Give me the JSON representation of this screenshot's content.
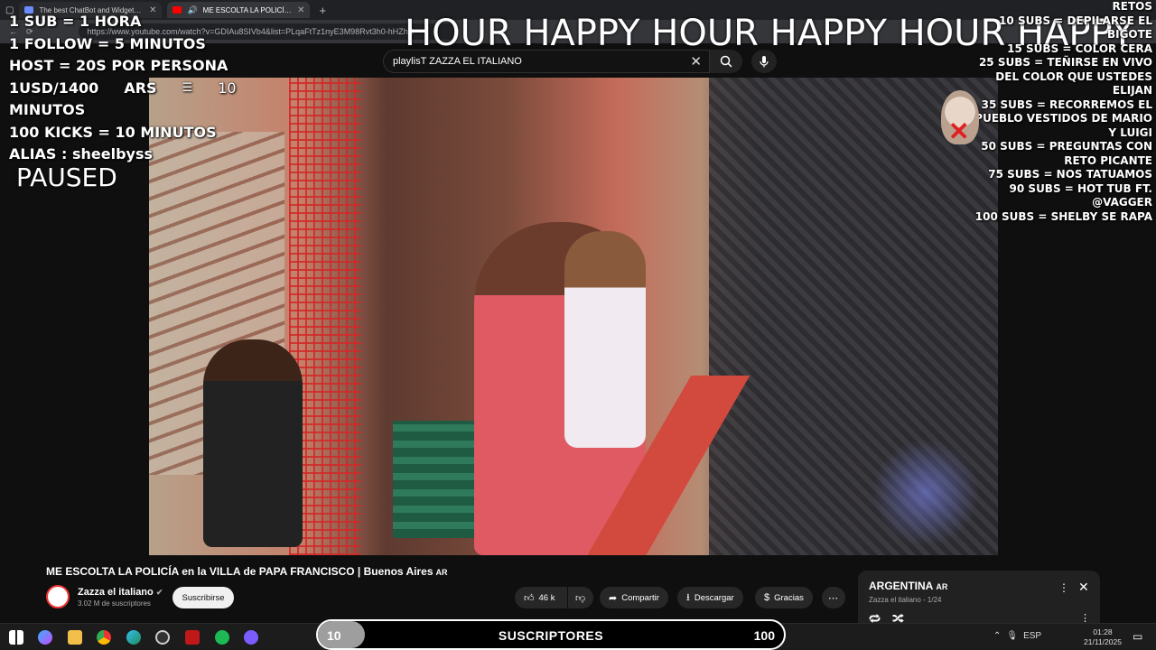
{
  "browser": {
    "tabs": [
      {
        "title": "The best ChatBot and Widgets fo",
        "active": false
      },
      {
        "title": "ME ESCOLTA LA POLICÍA en",
        "active": true
      }
    ],
    "url": "https://www.youtube.com/watch?v=GDIAu8SIVb4&list=PLqaFtTz1nyE3M98Rvt3h0-hHZhC"
  },
  "youtube": {
    "search_query": "playlisT ZAZZA EL ITALIANO",
    "video_title": "ME ESCOLTA LA POLICÍA en la VILLA de PAPA FRANCISCO | Buenos Aires",
    "title_suffix": "AR",
    "channel": {
      "name": "Zazza el italiano",
      "subs": "3.02 M de suscriptores",
      "subscribe_label": "Suscribirse"
    },
    "actions": {
      "likes": "46 k",
      "share": "Compartir",
      "download": "Descargar",
      "thanks": "Gracias"
    },
    "playlist": {
      "title": "ARGENTINA",
      "title_suffix": "AR",
      "subtitle": "Zazza el italiano - 1/24"
    }
  },
  "overlay": {
    "left_lines": [
      "1 SUB = 1 HORA",
      "1 FOLLOW = 5 MINUTOS",
      "HOST = 20S POR PERSONA"
    ],
    "usd_rate": "1USD/1400",
    "usd_currency": "ARS",
    "usd_value": "10",
    "minutos": "MINUTOS",
    "kicks": "100 KICKS = 10 MINUTOS",
    "alias": "ALIAS : sheelbyss",
    "paused": "PAUSED",
    "marquee": "HOUR HAPPY HOUR HAPPY HOUR HAPPY",
    "retos": [
      "RETOS",
      "10 SUBS = DEPILARSE EL BIGOTE",
      "15 SUBS = COLOR CERA",
      "25 SUBS = TEÑIRSE EN VIVO DEL COLOR QUE USTEDES ELIJAN",
      "35 SUBS = RECORREMOS EL PUEBLO VESTIDOS DE MARIO Y LUIGI",
      "50 SUBS = PREGUNTAS CON RETO PICANTE",
      "75 SUBS = NOS TATUAMOS",
      "90 SUBS = HOT TUB FT. @VAGGER",
      "100 SUBS = SHELBY SE RAPA"
    ]
  },
  "goal": {
    "current": "10",
    "label": "SUSCRIPTORES",
    "target": "100",
    "progress": 0.1
  },
  "taskbar": {
    "time": "01:28",
    "date": "21/11/2025",
    "lang": "ESP"
  }
}
